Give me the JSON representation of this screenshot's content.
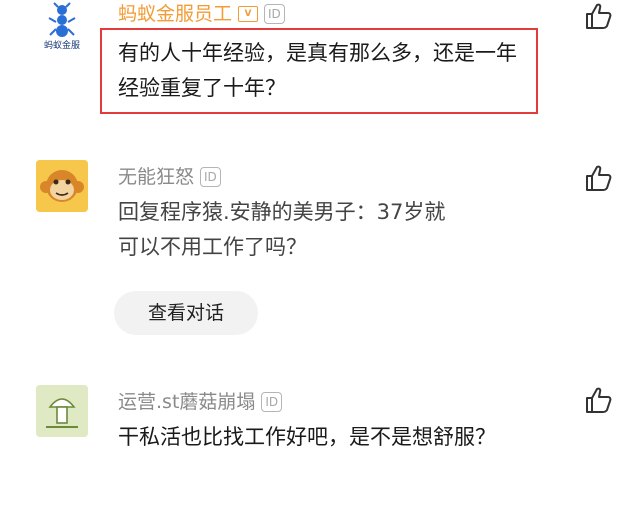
{
  "comments": [
    {
      "username": "蚂蚁金服员工",
      "verified_badge": "V",
      "id_badge": "ID",
      "avatar_caption": "蚂蚁金服",
      "text": "有的人十年经验，是真有那么多，还是一年经验重复了十年？",
      "highlight_color": "#e23b3b",
      "username_color": "#f39c35"
    },
    {
      "username": "无能狂怒",
      "id_badge": "ID",
      "text": "回复程序猿.安静的美男子：37岁就可以不用工作了吗？",
      "view_conversation_label": "查看对话"
    },
    {
      "username": "运营.st蘑菇崩塌",
      "id_badge": "ID",
      "text": "干私活也比找工作好吧，是不是想舒服？"
    }
  ],
  "icons": {
    "like": "thumbs-up-icon",
    "ant": "ant-logo-icon",
    "monkey": "monkey-face-icon",
    "mushroom": "mushroom-icon"
  }
}
